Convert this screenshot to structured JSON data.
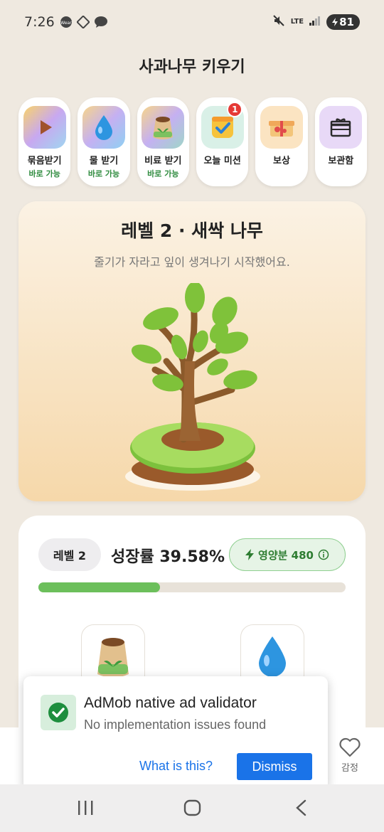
{
  "status_bar": {
    "time": "7:26",
    "left_icons": [
      "wear-icon",
      "puzzle-icon",
      "chat-icon"
    ],
    "lte": "LTE",
    "battery": "81"
  },
  "page": {
    "title": "사과나무 키우기"
  },
  "quick_actions": [
    {
      "label": "묶음받기",
      "sub": "바로 가능",
      "icon": "play-icon"
    },
    {
      "label": "물 받기",
      "sub": "바로 가능",
      "icon": "water-drop-icon"
    },
    {
      "label": "비료 받기",
      "sub": "바로 가능",
      "icon": "fertilizer-bag-icon"
    },
    {
      "label": "오늘 미션",
      "sub": "",
      "icon": "mission-check-icon",
      "badge": "1"
    },
    {
      "label": "보상",
      "sub": "",
      "icon": "gift-box-icon"
    },
    {
      "label": "보관함",
      "sub": "",
      "icon": "storage-box-icon"
    }
  ],
  "tree": {
    "title": "레벨 2 · 새싹 나무",
    "description": "줄기가 자라고 잎이 생겨나기 시작했어요."
  },
  "growth": {
    "level_label": "레벨 2",
    "growth_text": "성장률 39.58%",
    "progress_fraction": 0.3958,
    "nutrient_text": "영양분 480"
  },
  "bottom_nav": {
    "emotion_label": "감정"
  },
  "ad_popup": {
    "title": "AdMob native ad validator",
    "subtitle": "No implementation issues found",
    "what_link": "What is this?",
    "dismiss_label": "Dismiss"
  },
  "colors": {
    "accent_green": "#2e8b3e",
    "progress_green": "#6cbf5b",
    "badge_red": "#e53935",
    "link_blue": "#1a73e8"
  }
}
